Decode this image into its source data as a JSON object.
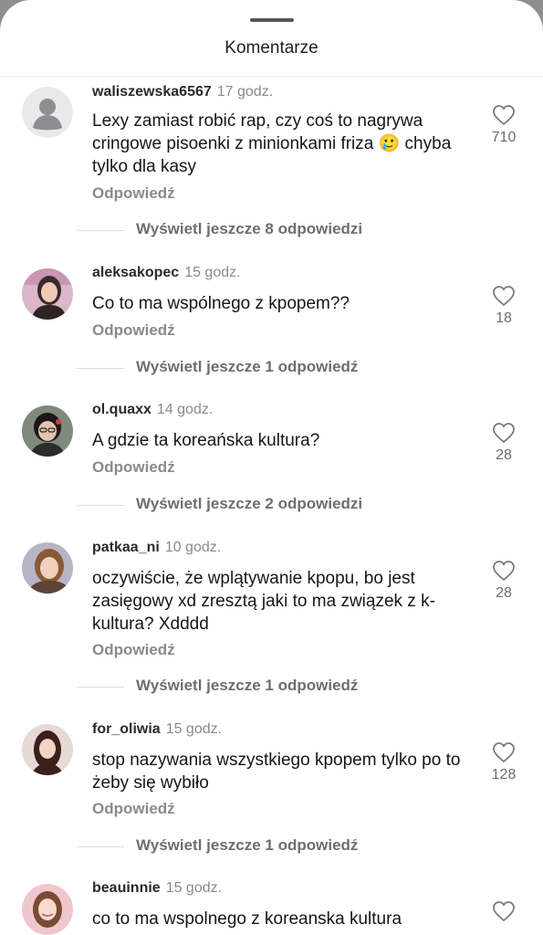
{
  "sheet": {
    "title": "Komentarze"
  },
  "comments": [
    {
      "username": "waliszewska6567",
      "time": "17 godz.",
      "text": "Lexy zamiast robić rap, czy coś to nagrywa cringowe pisoenki z minionkami friza 🥲 chyba tylko dla kasy",
      "reply_label": "Odpowiedź",
      "likes": "710",
      "view_replies": "Wyświetl jeszcze 8 odpowiedzi",
      "avatar_icon": "default-person-icon"
    },
    {
      "username": "aleksakopec",
      "time": "15 godz.",
      "text": "Co to ma wspólnego z kpopem??",
      "reply_label": "Odpowiedź",
      "likes": "18",
      "view_replies": "Wyświetl jeszcze 1 odpowiedź",
      "avatar_icon": "user-photo"
    },
    {
      "username": "ol.quaxx",
      "time": "14 godz.",
      "text": "A gdzie ta koreańska kultura?",
      "reply_label": "Odpowiedź",
      "likes": "28",
      "view_replies": "Wyświetl jeszcze 2 odpowiedzi",
      "avatar_icon": "user-photo"
    },
    {
      "username": "patkaa_ni",
      "time": "10 godz.",
      "text": "oczywiście, że wplątywanie kpopu, bo jest zasięgowy xd zresztą jaki to ma związek z k-kultura? Xdddd",
      "reply_label": "Odpowiedź",
      "likes": "28",
      "view_replies": "Wyświetl jeszcze 1 odpowiedź",
      "avatar_icon": "user-photo"
    },
    {
      "username": "for_oliwia",
      "time": "15 godz.",
      "text": "stop nazywania wszystkiego kpopem tylko po to żeby się wybiło",
      "reply_label": "Odpowiedź",
      "likes": "128",
      "view_replies": "Wyświetl jeszcze 1 odpowiedź",
      "avatar_icon": "user-photo"
    },
    {
      "username": "beauinnie",
      "time": "15 godz.",
      "text": "co to ma wspolnego z koreanska kultura",
      "likes": "",
      "avatar_icon": "user-photo"
    }
  ]
}
